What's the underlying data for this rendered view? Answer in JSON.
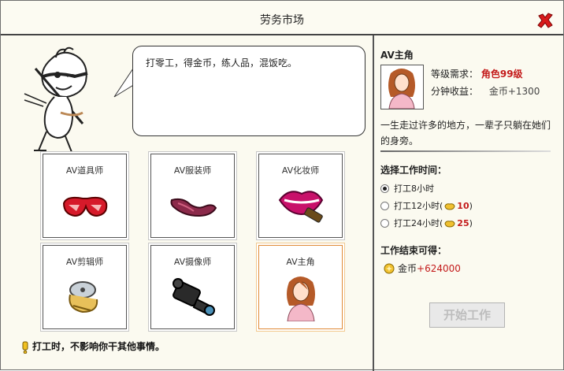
{
  "window": {
    "title": "劳务市场"
  },
  "speech": "打零工，得金币，练人品，混饭吃。",
  "jobs": [
    {
      "label": "AV道具师",
      "icon": "glasses-icon"
    },
    {
      "label": "AV服装师",
      "icon": "clothing-icon"
    },
    {
      "label": "AV化妆师",
      "icon": "lipstick-icon"
    },
    {
      "label": "AV剪辑师",
      "icon": "film-reel-icon"
    },
    {
      "label": "AV摄像师",
      "icon": "video-camera-icon"
    },
    {
      "label": "AV主角",
      "icon": "girl-avatar-icon"
    }
  ],
  "tip": "打工时，不影响你干其他事情。",
  "detail": {
    "name": "AV主角",
    "req_label": "等级需求：",
    "req_value": "角色99级",
    "earn_label": "分钟收益：",
    "earn_value": "金币+1300",
    "desc": "一生走过许多的地方，一辈子只躺在她们的身旁。"
  },
  "time_section": {
    "title": "选择工作时间：",
    "options": [
      {
        "label": "打工8小时",
        "selected": true
      },
      {
        "label": "打工12小时(",
        "cost": "10",
        "close": ")"
      },
      {
        "label": "打工24小时(",
        "cost": "25",
        "close": ")"
      }
    ]
  },
  "reward_section": {
    "title": "工作结束可得：",
    "label": "金币",
    "value": "+624000"
  },
  "start_button": "开始工作",
  "colors": {
    "accent_red": "#c31a1a",
    "selected_border": "#e08a36"
  }
}
